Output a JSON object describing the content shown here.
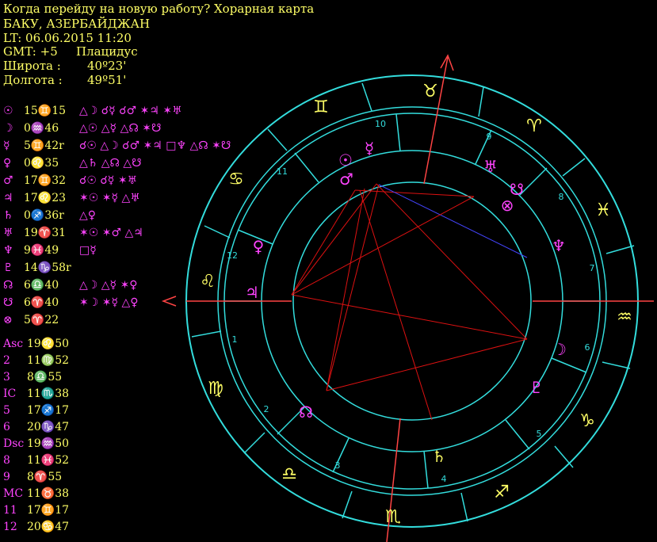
{
  "header": {
    "title": "Когда перейду на новую работу? Хорарная карта",
    "place": "БАКУ, АЗЕРБАЙДЖАН",
    "lt": "LT: 06.06.2015  11:20",
    "gmt": "GMT: +5",
    "system": "Плацидус",
    "lat_label": "Широта :",
    "lat_value": "40º23'",
    "lon_label": "Долгота :",
    "lon_value": "49º51'"
  },
  "planets": [
    {
      "glyph": "☉",
      "pos": "15♊15",
      "aspects": "△☽ ☌☿ ☌♂ ✶♃ ✶♅"
    },
    {
      "glyph": "☽",
      "pos": "0♒46",
      "aspects": "△☉ △☿ △☊ ✶☋"
    },
    {
      "glyph": "☿",
      "pos": "5♊42r",
      "aspects": "☌☉ △☽ ☌♂ ✶♃ □♆ △☊ ✶☋"
    },
    {
      "glyph": "♀",
      "pos": "0♌35",
      "aspects": "△♄ △☊ △☋"
    },
    {
      "glyph": "♂",
      "pos": "17♊32",
      "aspects": "☌☉ ☌☿ ✶♅"
    },
    {
      "glyph": "♃",
      "pos": "17♌23",
      "aspects": "✶☉ ✶☿ △♅"
    },
    {
      "glyph": "♄",
      "pos": "0♐36r",
      "aspects": "△♀"
    },
    {
      "glyph": "♅",
      "pos": "19♈31",
      "aspects": "✶☉ ✶♂ △♃"
    },
    {
      "glyph": "♆",
      "pos": "9♓49",
      "aspects": "□☿"
    },
    {
      "glyph": "♇",
      "pos": "14♑58r",
      "aspects": ""
    },
    {
      "glyph": "☊",
      "pos": "6♎40",
      "aspects": "△☽ △☿ ✶♀"
    },
    {
      "glyph": "☋",
      "pos": "6♈40",
      "aspects": "✶☽ ✶☿ △♀"
    },
    {
      "glyph": "⊗",
      "pos": "5♈22",
      "aspects": ""
    }
  ],
  "cusps": [
    {
      "label": "Asc",
      "pos": "19♌50"
    },
    {
      "label": "2",
      "pos": "11♍52"
    },
    {
      "label": "3",
      "pos": "8♎55"
    },
    {
      "label": "IC",
      "pos": "11♏38"
    },
    {
      "label": "5",
      "pos": "17♐17"
    },
    {
      "label": "6",
      "pos": "20♑47"
    },
    {
      "label": "Dsc",
      "pos": "19♒50"
    },
    {
      "label": "8",
      "pos": "11♓52"
    },
    {
      "label": "9",
      "pos": "8♈55"
    },
    {
      "label": "MC",
      "pos": "11♉38"
    },
    {
      "label": "11",
      "pos": "17♊17"
    },
    {
      "label": "12",
      "pos": "20♋47"
    }
  ],
  "wheel": {
    "house_numbers": [
      "1",
      "2",
      "3",
      "4",
      "5",
      "6",
      "7",
      "8",
      "9",
      "10",
      "11",
      "12"
    ],
    "sign_glyphs": [
      "♉",
      "♈",
      "♓",
      "♒",
      "♑",
      "♐",
      "♏",
      "♎",
      "♍",
      "♌",
      "♋",
      "♊"
    ],
    "wheel_planet_glyphs": [
      "☿",
      "☉",
      "♂",
      "♅",
      "☋",
      "⊗",
      "♆",
      "☽",
      "♇",
      "♄",
      "☊",
      "♃",
      "♀"
    ],
    "colors": {
      "ring": "#33dddd",
      "sign_yellow": "#ffff66",
      "planet_magenta": "#ff44ff",
      "aspect_red": "#dd1111",
      "aspect_blue": "#4444ff",
      "axis": "#ff4444"
    }
  }
}
